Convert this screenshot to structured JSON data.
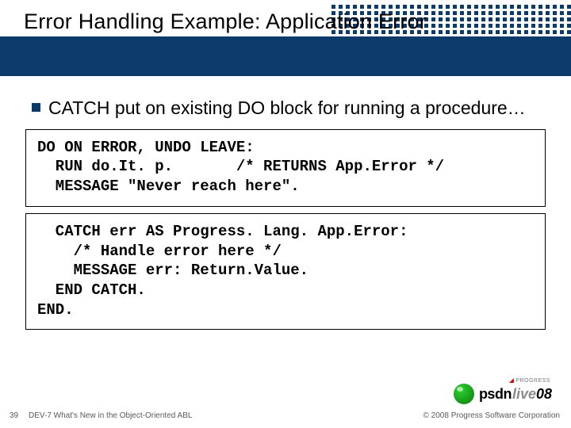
{
  "title": "Error Handling Example: Application Error",
  "bullet": "CATCH put on existing DO block for running a procedure…",
  "code1_line1": "DO ON ERROR, UNDO LEAVE:",
  "code1_line2": "  RUN do.It. p.       /* RETURNS App.Error */",
  "code1_line3": "  MESSAGE \"Never reach here\".",
  "code2_line1": "  CATCH err AS Progress. Lang. App.Error:",
  "code2_line2": "    /* Handle error here */",
  "code2_line3": "    MESSAGE err: Return.Value.",
  "code2_line4": "  END CATCH.",
  "code2_line5": "END.",
  "footer": {
    "page": "39",
    "left": "DEV-7 What's New in the Object-Oriented ABL",
    "right": "© 2008 Progress Software Corporation"
  },
  "logo": {
    "progress_label": "PROGRESS",
    "psdn": "psdn",
    "live": "live",
    "year": "08"
  }
}
